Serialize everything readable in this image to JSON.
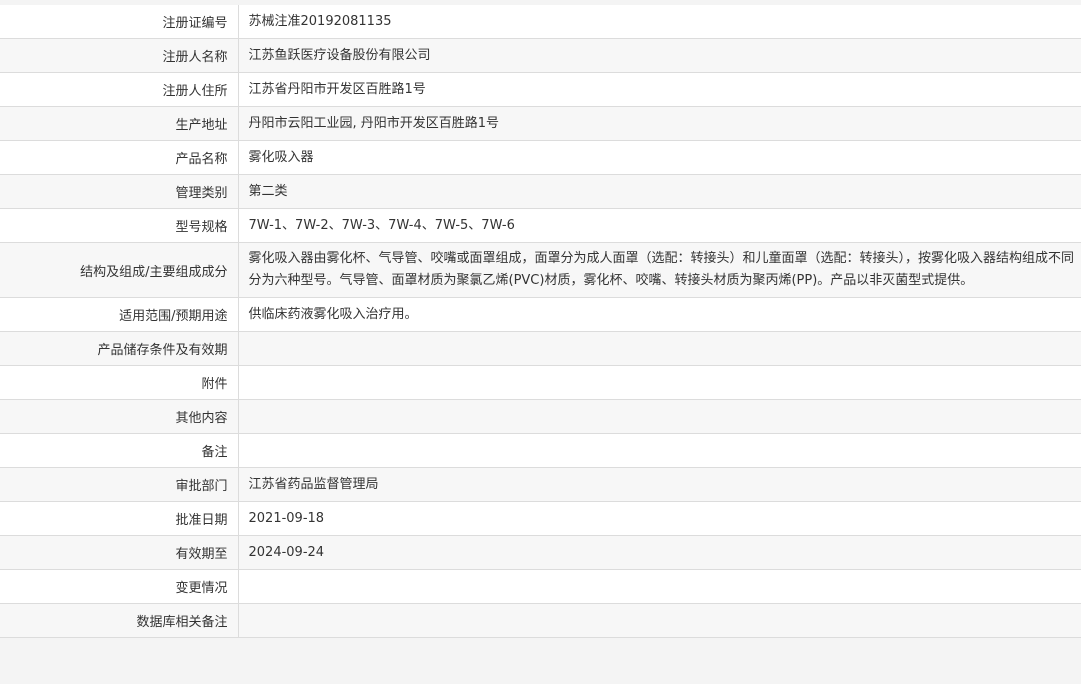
{
  "rows": [
    {
      "label": "注册证编号",
      "value": "苏械注准20192081135"
    },
    {
      "label": "注册人名称",
      "value": "江苏鱼跃医疗设备股份有限公司"
    },
    {
      "label": "注册人住所",
      "value": "江苏省丹阳市开发区百胜路1号"
    },
    {
      "label": "生产地址",
      "value": "丹阳市云阳工业园, 丹阳市开发区百胜路1号"
    },
    {
      "label": "产品名称",
      "value": "雾化吸入器"
    },
    {
      "label": "管理类别",
      "value": "第二类"
    },
    {
      "label": "型号规格",
      "value": "7W-1、7W-2、7W-3、7W-4、7W-5、7W-6"
    },
    {
      "label": "结构及组成/主要组成成分",
      "value": "雾化吸入器由雾化杯、气导管、咬嘴或面罩组成，面罩分为成人面罩（选配：转接头）和儿童面罩（选配：转接头），按雾化吸入器结构组成不同分为六种型号。气导管、面罩材质为聚氯乙烯(PVC)材质，雾化杯、咬嘴、转接头材质为聚丙烯(PP)。产品以非灭菌型式提供。"
    },
    {
      "label": "适用范围/预期用途",
      "value": "供临床药液雾化吸入治疗用。"
    },
    {
      "label": "产品储存条件及有效期",
      "value": ""
    },
    {
      "label": "附件",
      "value": ""
    },
    {
      "label": "其他内容",
      "value": ""
    },
    {
      "label": "备注",
      "value": ""
    },
    {
      "label": "审批部门",
      "value": "江苏省药品监督管理局"
    },
    {
      "label": "批准日期",
      "value": "2021-09-18"
    },
    {
      "label": "有效期至",
      "value": "2024-09-24"
    },
    {
      "label": "变更情况",
      "value": ""
    },
    {
      "label": "数据库相关备注",
      "value": ""
    }
  ]
}
